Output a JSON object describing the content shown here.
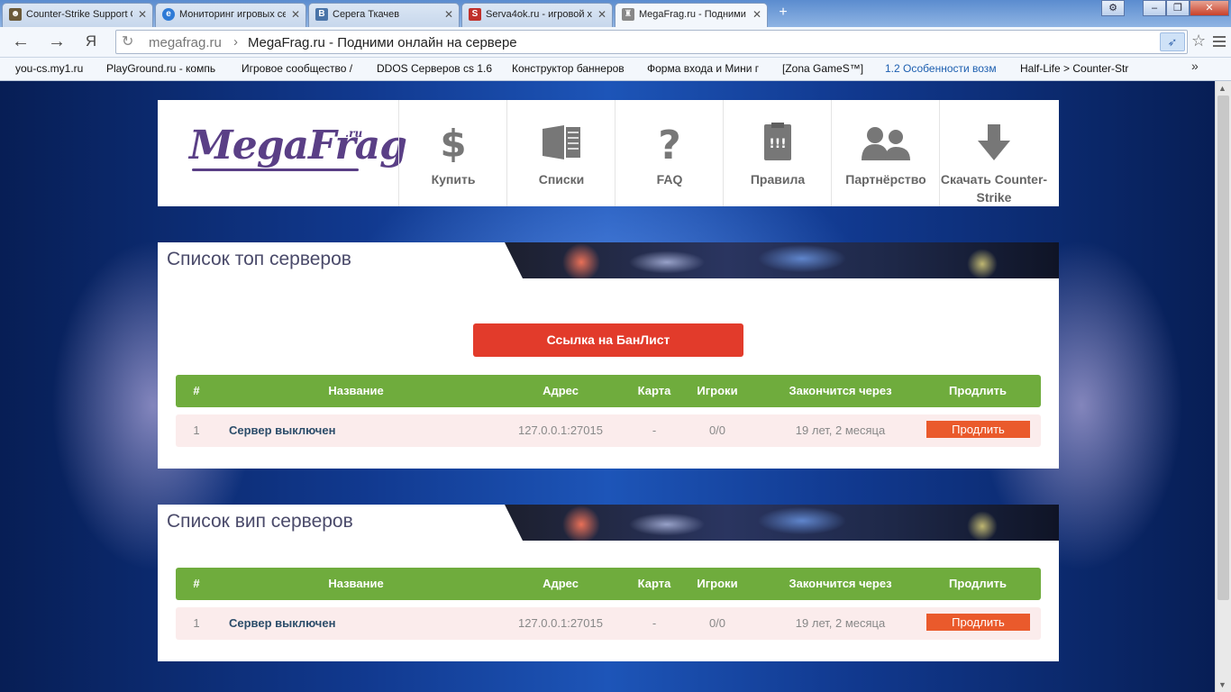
{
  "browser": {
    "tabs": [
      {
        "title": "Counter-Strike Support G",
        "favicon": "person-icon",
        "color": "#6b5a3a",
        "active": false
      },
      {
        "title": "Мониторинг игровых се",
        "favicon": "e-icon",
        "color": "#2d7ad6",
        "active": false
      },
      {
        "title": "Серега Ткачев",
        "favicon": "vk-icon",
        "color": "#4a74a8",
        "active": false
      },
      {
        "title": "Serva4ok.ru - игровой х",
        "favicon": "serva4ok-icon",
        "color": "#c0302a",
        "active": false
      },
      {
        "title": "MegaFrag.ru - Подними",
        "favicon": "soldier-icon",
        "color": "#666666",
        "active": true
      }
    ],
    "new_tab": "+",
    "window_buttons": {
      "settings": "⚙",
      "minimize": "–",
      "maximize": "❐",
      "close": "✕"
    },
    "nav": {
      "back": "←",
      "forward": "→",
      "yandex": "Я"
    },
    "address": {
      "reload": "↻",
      "domain": "megafrag.ru",
      "separator": "›",
      "title": "MegaFrag.ru - Подними онлайн на сервере"
    },
    "bookmarks": [
      "you-cs.my1.ru",
      "PlayGround.ru - компь",
      "Игровое сообщество /",
      "DDOS Серверов cs 1.6",
      "Конструктор баннеров",
      "Форма входа и Мини г",
      "[Zona GameS™]",
      "1.2 Особенности возм",
      "Half-Life > Counter-Str"
    ],
    "bookmarks_more": "»"
  },
  "header": {
    "logo": "MegaFrag",
    "logo_suffix": ".ru",
    "nav": [
      {
        "label": "Купить",
        "icon": "dollar-icon"
      },
      {
        "label": "Списки",
        "icon": "list-icon"
      },
      {
        "label": "FAQ",
        "icon": "question-icon"
      },
      {
        "label": "Правила",
        "icon": "rules-icon"
      },
      {
        "label": "Партнёрство",
        "icon": "partners-icon"
      },
      {
        "label": "Скачать Counter-Strike",
        "icon": "download-icon"
      }
    ]
  },
  "top_servers": {
    "title": "Список топ серверов",
    "banlist_button": "Ссылка на БанЛист",
    "columns": [
      "#",
      "Название",
      "Адрес",
      "Карта",
      "Игроки",
      "Закончится через",
      "Продлить"
    ],
    "rows": [
      {
        "num": "1",
        "name": "Сервер выключен",
        "address": "127.0.0.1:27015",
        "map": "-",
        "players": "0/0",
        "expires": "19 лет, 2 месяца",
        "action": "Продлить"
      }
    ]
  },
  "vip_servers": {
    "title": "Список вип серверов",
    "columns": [
      "#",
      "Название",
      "Адрес",
      "Карта",
      "Игроки",
      "Закончится через",
      "Продлить"
    ],
    "rows": [
      {
        "num": "1",
        "name": "Сервер выключен",
        "address": "127.0.0.1:27015",
        "map": "-",
        "players": "0/0",
        "expires": "19 лет, 2 месяца",
        "action": "Продлить"
      }
    ]
  },
  "colors": {
    "accent_green": "#6fac3d",
    "banlist_red": "#e23b2b",
    "prolong_orange": "#ea5a2c",
    "logo_purple": "#5a3f86"
  }
}
